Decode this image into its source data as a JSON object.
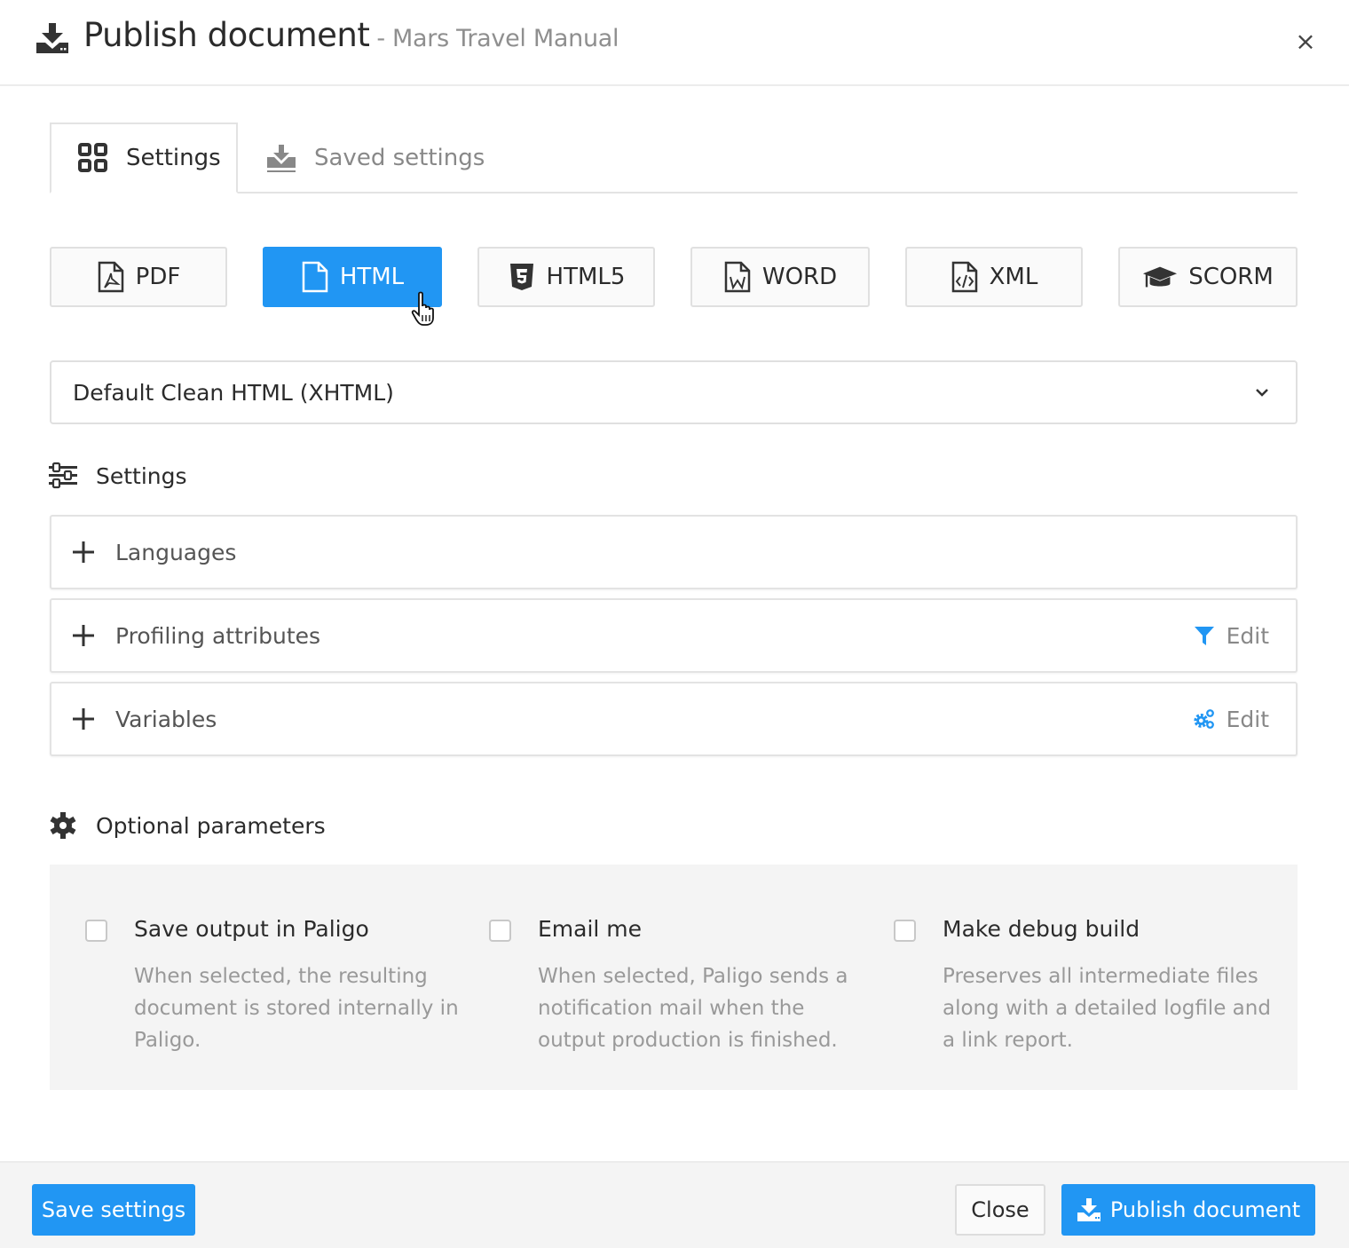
{
  "dialog": {
    "title": "Publish document",
    "subtitle": "- Mars Travel Manual",
    "close_label": "×"
  },
  "tabs": [
    {
      "label": "Settings",
      "icon": "grid-icon",
      "active": true
    },
    {
      "label": "Saved settings",
      "icon": "download-tray-icon",
      "active": false
    }
  ],
  "formats": [
    {
      "label": "PDF",
      "icon": "file-pdf-icon",
      "active": false
    },
    {
      "label": "HTML",
      "icon": "file-icon",
      "active": true
    },
    {
      "label": "HTML5",
      "icon": "html5-icon",
      "active": false
    },
    {
      "label": "WORD",
      "icon": "file-word-icon",
      "active": false
    },
    {
      "label": "XML",
      "icon": "file-code-icon",
      "active": false
    },
    {
      "label": "SCORM",
      "icon": "graduation-cap-icon",
      "active": false
    }
  ],
  "layout_select": {
    "value": "Default Clean HTML (XHTML)"
  },
  "settings_section": {
    "heading": "Settings",
    "items": [
      {
        "label": "Languages",
        "edit_label": null
      },
      {
        "label": "Profiling attributes",
        "edit_label": "Edit",
        "edit_icon": "filter-icon"
      },
      {
        "label": "Variables",
        "edit_label": "Edit",
        "edit_icon": "cogs-icon"
      }
    ]
  },
  "optional_parameters": {
    "heading": "Optional parameters",
    "options": [
      {
        "title": "Save output in Paligo",
        "description": "When selected, the resulting document is stored internally in Paligo.",
        "checked": false
      },
      {
        "title": "Email me",
        "description": "When selected, Paligo sends a notification mail when the output production is finished.",
        "checked": false
      },
      {
        "title": "Make debug build",
        "description": "Preserves all intermediate files along with a detailed logfile and a link report.",
        "checked": false
      }
    ]
  },
  "footer": {
    "save_settings_label": "Save settings",
    "close_label": "Close",
    "publish_label": "Publish document"
  },
  "colors": {
    "accent": "#2196f3",
    "text": "#2b2b2b",
    "muted": "#999999"
  }
}
